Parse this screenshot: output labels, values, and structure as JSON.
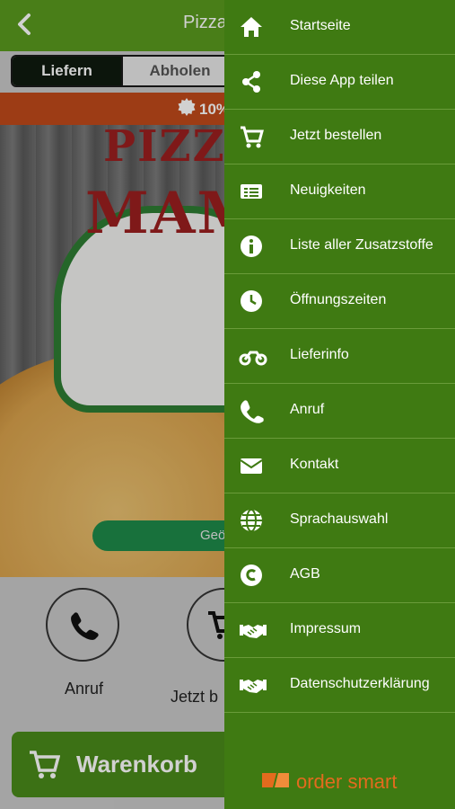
{
  "header": {
    "title": "Pizza",
    "back_icon": "chevron-left-icon"
  },
  "order_mode": {
    "options": [
      "Liefern",
      "Abholen"
    ],
    "selected": "Liefern"
  },
  "promo": {
    "text": "10%",
    "icon": "badge-icon"
  },
  "hero": {
    "logo_line1": "PIZZA",
    "logo_line2": "MAM",
    "pill_text": "Geö"
  },
  "actions": [
    {
      "label": "Anruf",
      "icon": "phone-icon"
    },
    {
      "label": "Jetzt b",
      "icon": "cart-icon"
    }
  ],
  "cart": {
    "label": "Warenkorb"
  },
  "menu": {
    "items": [
      {
        "label": "Startseite",
        "icon": "home-icon"
      },
      {
        "label": "Diese App teilen",
        "icon": "share-icon"
      },
      {
        "label": "Jetzt bestellen",
        "icon": "cart-icon"
      },
      {
        "label": "Neuigkeiten",
        "icon": "news-icon"
      },
      {
        "label": "Liste aller Zusatzstoffe",
        "icon": "info-icon"
      },
      {
        "label": "Öffnungszeiten",
        "icon": "clock-icon"
      },
      {
        "label": "Lieferinfo",
        "icon": "motorbike-icon"
      },
      {
        "label": "Anruf",
        "icon": "phone-icon"
      },
      {
        "label": "Kontakt",
        "icon": "mail-icon"
      },
      {
        "label": "Sprachauswahl",
        "icon": "globe-icon"
      },
      {
        "label": "AGB",
        "icon": "copyright-icon"
      },
      {
        "label": "Impressum",
        "icon": "handshake-icon"
      },
      {
        "label": "Datenschutzerklärung",
        "icon": "handshake-icon"
      }
    ],
    "footer_brand": "order smart"
  },
  "colors": {
    "topbar": "#5a9a1e",
    "drawer": "#3f7a12",
    "promo": "#c04a1a",
    "brand": "#e36b1e"
  }
}
